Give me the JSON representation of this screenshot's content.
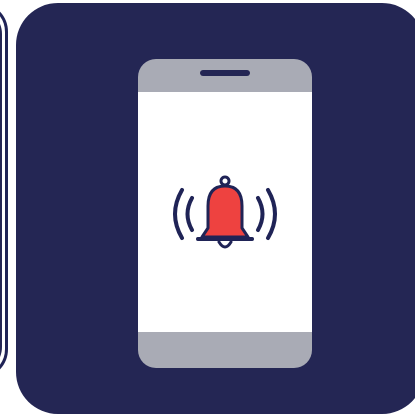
{
  "icon": {
    "left_tile": "app-tile",
    "main_tile": "app-tile",
    "glyph": "notification-bell-icon",
    "device": "smartphone-icon"
  },
  "colors": {
    "tile_background": "#242654",
    "phone_frame": "#a9abb5",
    "phone_screen": "#ffffff",
    "bell_fill": "#ee4240",
    "outline": "#1f2356"
  }
}
